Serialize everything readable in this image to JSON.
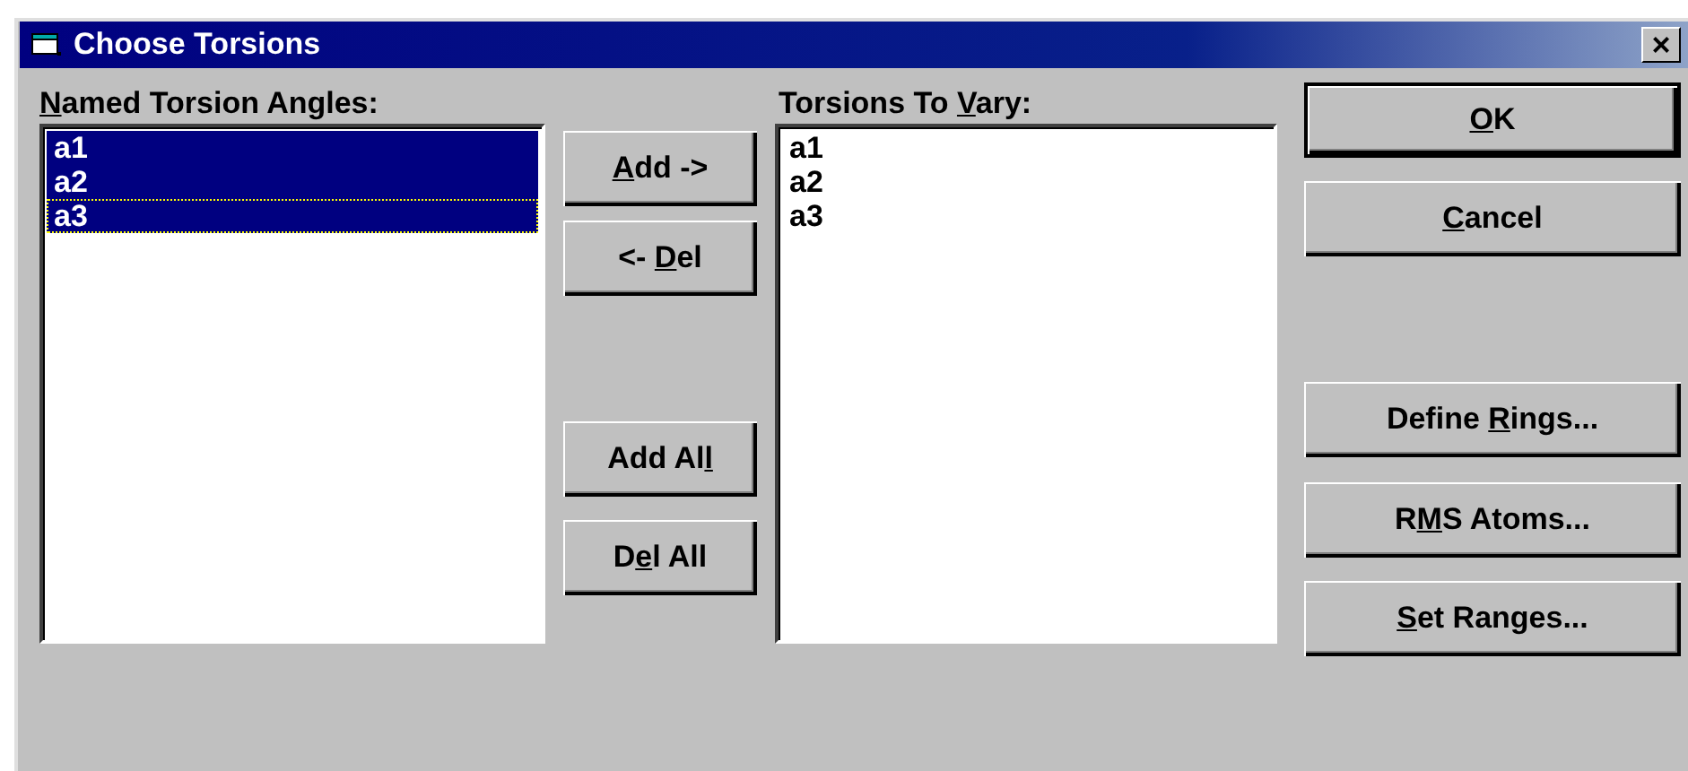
{
  "window": {
    "title": "Choose Torsions",
    "close": "×"
  },
  "named_list": {
    "label": [
      {
        "text": "N",
        "underline": true
      },
      {
        "text": "amed Torsion Angles:",
        "underline": false
      }
    ],
    "items": [
      {
        "text": "a1",
        "selected": true,
        "focused": false
      },
      {
        "text": "a2",
        "selected": true,
        "focused": false
      },
      {
        "text": "a3",
        "selected": true,
        "focused": true
      }
    ]
  },
  "middle_buttons": [
    {
      "label": [
        {
          "text": "A",
          "underline": true
        },
        {
          "text": "dd ->",
          "underline": false
        }
      ]
    },
    {
      "label": [
        {
          "text": "<- ",
          "underline": false
        },
        {
          "text": "D",
          "underline": true
        },
        {
          "text": "el",
          "underline": false
        }
      ]
    },
    {
      "label": [
        {
          "text": "Add Al",
          "underline": false
        },
        {
          "text": "l",
          "underline": true
        }
      ]
    },
    {
      "label": [
        {
          "text": "D",
          "underline": false
        },
        {
          "text": "e",
          "underline": true
        },
        {
          "text": "l All",
          "underline": false
        }
      ]
    }
  ],
  "vary_list": {
    "label": [
      {
        "text": "Torsions To ",
        "underline": false
      },
      {
        "text": "V",
        "underline": true
      },
      {
        "text": "ary:",
        "underline": false
      }
    ],
    "items": [
      {
        "text": "a1",
        "selected": false,
        "focused": false
      },
      {
        "text": "a2",
        "selected": false,
        "focused": false
      },
      {
        "text": "a3",
        "selected": false,
        "focused": false
      }
    ]
  },
  "right_buttons": [
    {
      "label": [
        {
          "text": "O",
          "underline": true
        },
        {
          "text": "K",
          "underline": false
        }
      ],
      "default": true
    },
    {
      "label": [
        {
          "text": "C",
          "underline": true
        },
        {
          "text": "ancel",
          "underline": false
        }
      ],
      "default": false
    },
    {
      "label": [
        {
          "text": "Define ",
          "underline": false
        },
        {
          "text": "R",
          "underline": true
        },
        {
          "text": "ings...",
          "underline": false
        }
      ],
      "default": false
    },
    {
      "label": [
        {
          "text": "R",
          "underline": false
        },
        {
          "text": "M",
          "underline": true
        },
        {
          "text": "S Atoms...",
          "underline": false
        }
      ],
      "default": false
    },
    {
      "label": [
        {
          "text": "S",
          "underline": true
        },
        {
          "text": "et Ranges...",
          "underline": false
        }
      ],
      "default": false
    }
  ]
}
